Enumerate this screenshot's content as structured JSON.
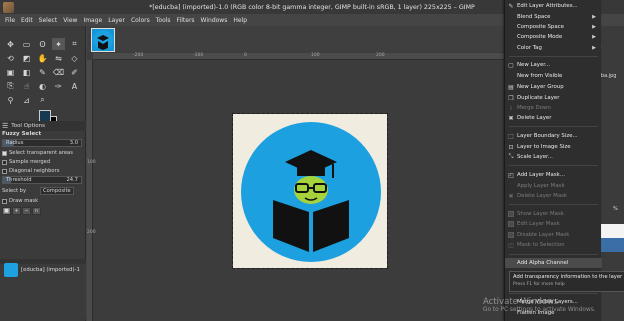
{
  "window": {
    "title": "*[educba] (imported)-1.0 (RGB color 8-bit gamma integer, GIMP built-in sRGB, 1 layer) 225x225 – GIMP"
  },
  "menubar": [
    "File",
    "Edit",
    "Select",
    "View",
    "Image",
    "Layer",
    "Colors",
    "Tools",
    "Filters",
    "Windows",
    "Help"
  ],
  "tool_options": {
    "tab_label": "Tool Options",
    "title": "Fuzzy Select",
    "radius_label": "Radius",
    "radius_value": "3.0",
    "select_transparent": "Select transparent areas",
    "sample_merged": "Sample merged",
    "diagonal_neighbors": "Diagonal neighbors",
    "threshold_label": "Threshold",
    "threshold_value": "24.7",
    "select_by_label": "Select by",
    "select_by_value": "Composite",
    "draw_mask": "Draw mask"
  },
  "images": {
    "item_label": "[educba] (imported)-1"
  },
  "rulers": {
    "h_ticks": [
      "-200",
      "-100",
      "0",
      "100",
      "200"
    ],
    "v_ticks": [
      "100",
      "200"
    ]
  },
  "right_panel": {
    "filename": "ucba.jpg",
    "mode_label": "%"
  },
  "context_menu": {
    "items": [
      {
        "label": "Edit Layer Attributes...",
        "icon": "edit-icon",
        "disabled": false
      },
      {
        "label": "Blend Space",
        "submenu": true,
        "disabled": false
      },
      {
        "label": "Composite Space",
        "submenu": true,
        "disabled": false
      },
      {
        "label": "Composite Mode",
        "submenu": true,
        "disabled": false
      },
      {
        "label": "Color Tag",
        "submenu": true,
        "disabled": false
      },
      {
        "label": "New Layer...",
        "icon": "new-layer-icon",
        "disabled": false
      },
      {
        "label": "New from Visible",
        "disabled": false
      },
      {
        "label": "New Layer Group",
        "icon": "folder-icon",
        "disabled": false
      },
      {
        "label": "Duplicate Layer",
        "icon": "duplicate-icon",
        "disabled": false
      },
      {
        "label": "Merge Down",
        "icon": "merge-down-icon",
        "disabled": true
      },
      {
        "label": "Delete Layer",
        "icon": "delete-icon",
        "disabled": false
      },
      {
        "label": "Layer Boundary Size...",
        "icon": "boundary-icon",
        "disabled": false
      },
      {
        "label": "Layer to Image Size",
        "icon": "to-image-size-icon",
        "disabled": false
      },
      {
        "label": "Scale Layer...",
        "icon": "scale-icon",
        "disabled": false
      },
      {
        "label": "Add Layer Mask...",
        "icon": "add-mask-icon",
        "disabled": false
      },
      {
        "label": "Apply Layer Mask",
        "disabled": true
      },
      {
        "label": "Delete Layer Mask",
        "icon": "delete-mask-icon",
        "disabled": true
      },
      {
        "label": "Show Layer Mask",
        "disabled": true
      },
      {
        "label": "Edit Layer Mask",
        "disabled": true
      },
      {
        "label": "Disable Layer Mask",
        "disabled": true
      },
      {
        "label": "Mask to Selection",
        "icon": "mask-selection-icon",
        "disabled": true
      },
      {
        "label": "Add Alpha Channel",
        "disabled": false
      },
      {
        "label": "Merge Visible Layers...",
        "disabled": false
      },
      {
        "label": "Flatten Image",
        "disabled": false
      }
    ]
  },
  "tooltip": {
    "text": "Add transparency information to the layer",
    "hint": "Press F1 for more help"
  },
  "watermark": {
    "line1": "Activate Windows",
    "line2": "Go to PC settings to activate Windows."
  }
}
